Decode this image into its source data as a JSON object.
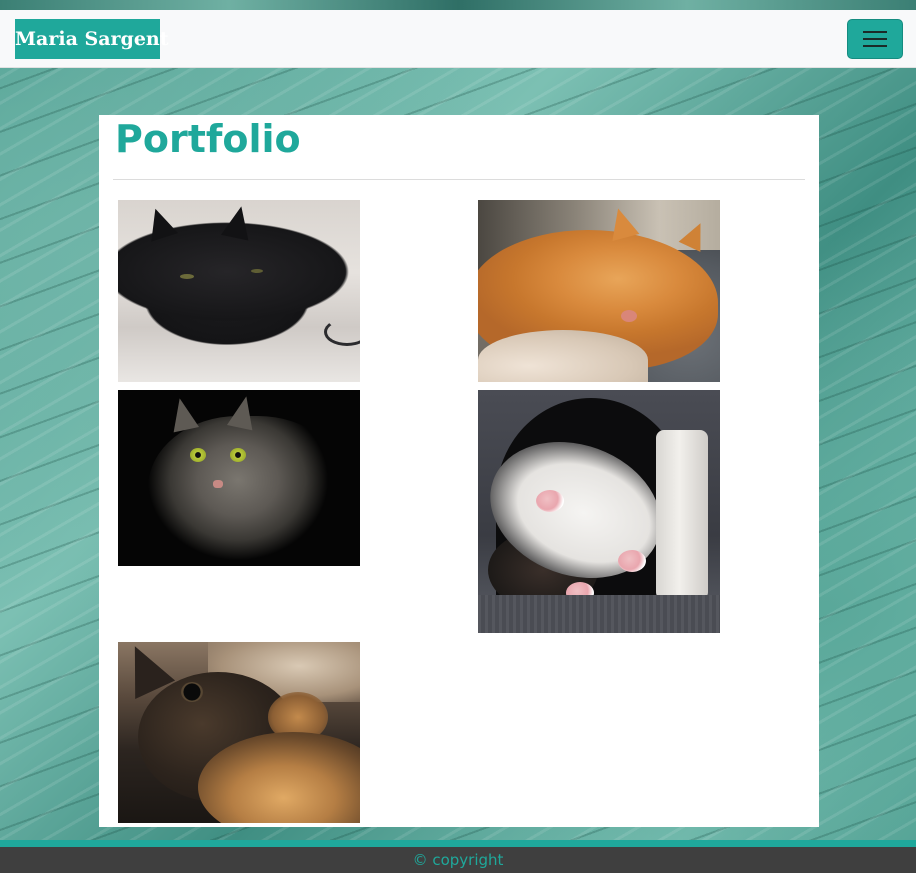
{
  "navbar": {
    "brand": "Maria Sargent",
    "toggler_icon": "hamburger-menu-icon"
  },
  "main": {
    "title": "Portfolio",
    "gallery": [
      {
        "subject": "black cat lying on white bed"
      },
      {
        "subject": "orange cat sleeping on gray blanket"
      },
      {
        "subject": "gray long-haired cat on black background"
      },
      {
        "subject": "tuxedo cat lying upside down in cat tree"
      },
      {
        "subject": "tortoiseshell cat close-up"
      }
    ]
  },
  "footer": {
    "copyright": "© copyright"
  },
  "colors": {
    "accent": "#1fa89b",
    "navbar_bg": "#f8f9fa",
    "footer_bg": "#3f3f3f",
    "panel_bg": "#ffffff"
  }
}
